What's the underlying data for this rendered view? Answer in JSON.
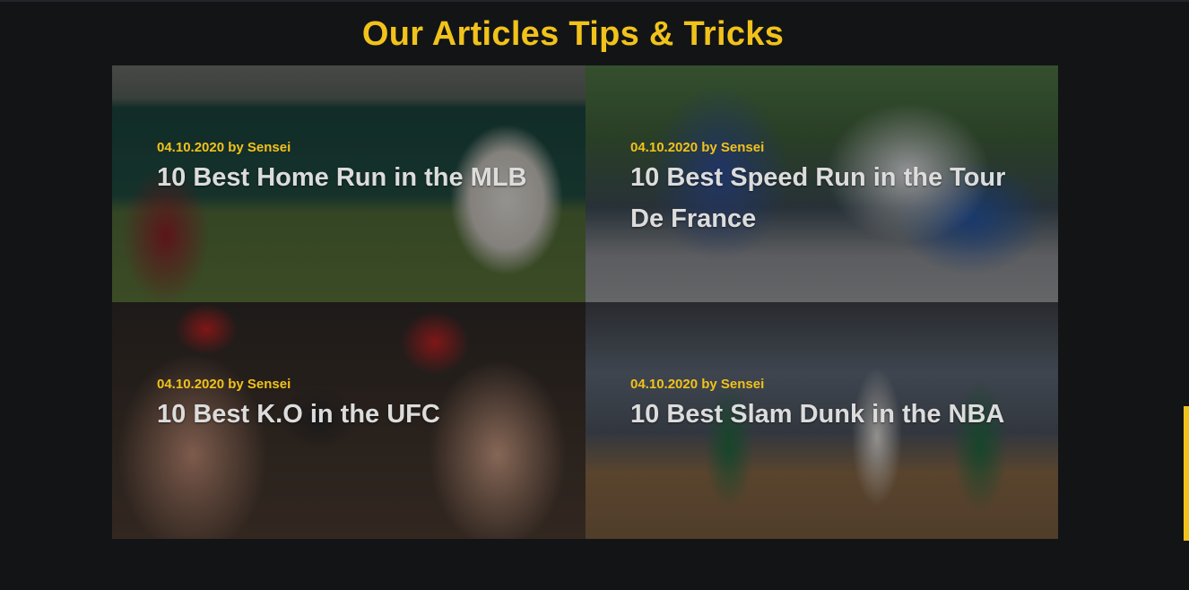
{
  "section": {
    "title": "Our Articles Tips & Tricks"
  },
  "articles": [
    {
      "meta": "04.10.2020 by Sensei",
      "headline": "10 Best Home Run in the MLB",
      "image": "baseball-photo"
    },
    {
      "meta": "04.10.2020 by Sensei",
      "headline": "10 Best Speed Run in the Tour De France",
      "image": "cycling-photo"
    },
    {
      "meta": "04.10.2020 by Sensei",
      "headline": "10 Best K.O in the UFC",
      "image": "boxing-photo"
    },
    {
      "meta": "04.10.2020 by Sensei",
      "headline": "10 Best Slam Dunk in the NBA",
      "image": "basketball-photo"
    }
  ],
  "colors": {
    "accent": "#f1c21b",
    "background": "#131416",
    "headline": "#dcdcdc"
  }
}
